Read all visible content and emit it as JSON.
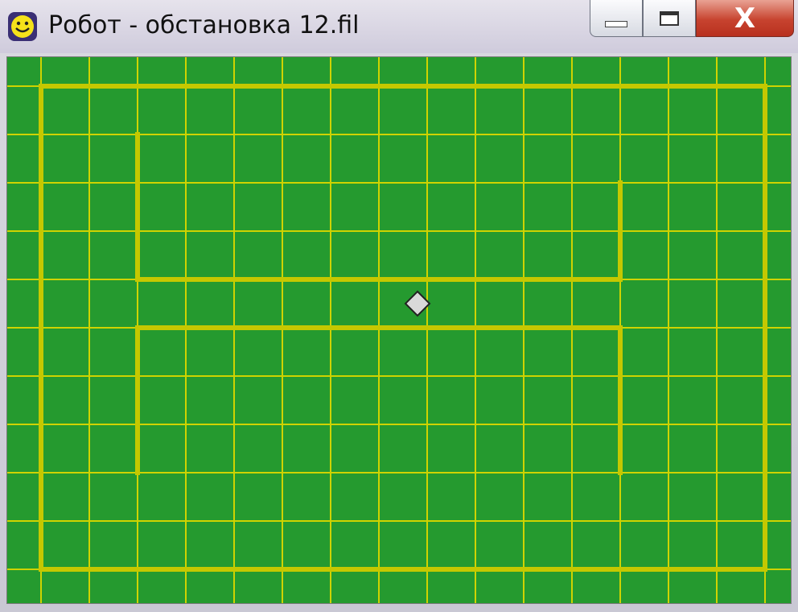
{
  "window": {
    "title": "Робот - обстановка 12.fil",
    "icon": "smiley-icon",
    "controls": {
      "minimize_icon": "minimize-icon",
      "maximize_icon": "maximize-icon",
      "close_icon": "close-icon",
      "close_label": "X"
    }
  },
  "field": {
    "columns": 16,
    "rows": 11,
    "background_color": "#259a2f",
    "grid_color": "#cfd300",
    "wall_color": "#c5c800",
    "robot": {
      "col": 8,
      "row": 5,
      "icon": "robot-diamond-icon",
      "color": "#d9d9d9"
    },
    "walls": [
      {
        "from": [
          0,
          0
        ],
        "to": [
          15,
          0
        ]
      },
      {
        "from": [
          15,
          0
        ],
        "to": [
          15,
          10
        ]
      },
      {
        "from": [
          0,
          10
        ],
        "to": [
          15,
          10
        ]
      },
      {
        "from": [
          0,
          0
        ],
        "to": [
          0,
          10
        ]
      },
      {
        "from": [
          2,
          1
        ],
        "to": [
          2,
          4
        ]
      },
      {
        "from": [
          2,
          4
        ],
        "to": [
          12,
          4
        ]
      },
      {
        "from": [
          12,
          2
        ],
        "to": [
          12,
          4
        ]
      },
      {
        "from": [
          2,
          5
        ],
        "to": [
          12,
          5
        ]
      },
      {
        "from": [
          2,
          5
        ],
        "to": [
          2,
          8
        ]
      },
      {
        "from": [
          12,
          5
        ],
        "to": [
          12,
          8
        ]
      }
    ]
  }
}
